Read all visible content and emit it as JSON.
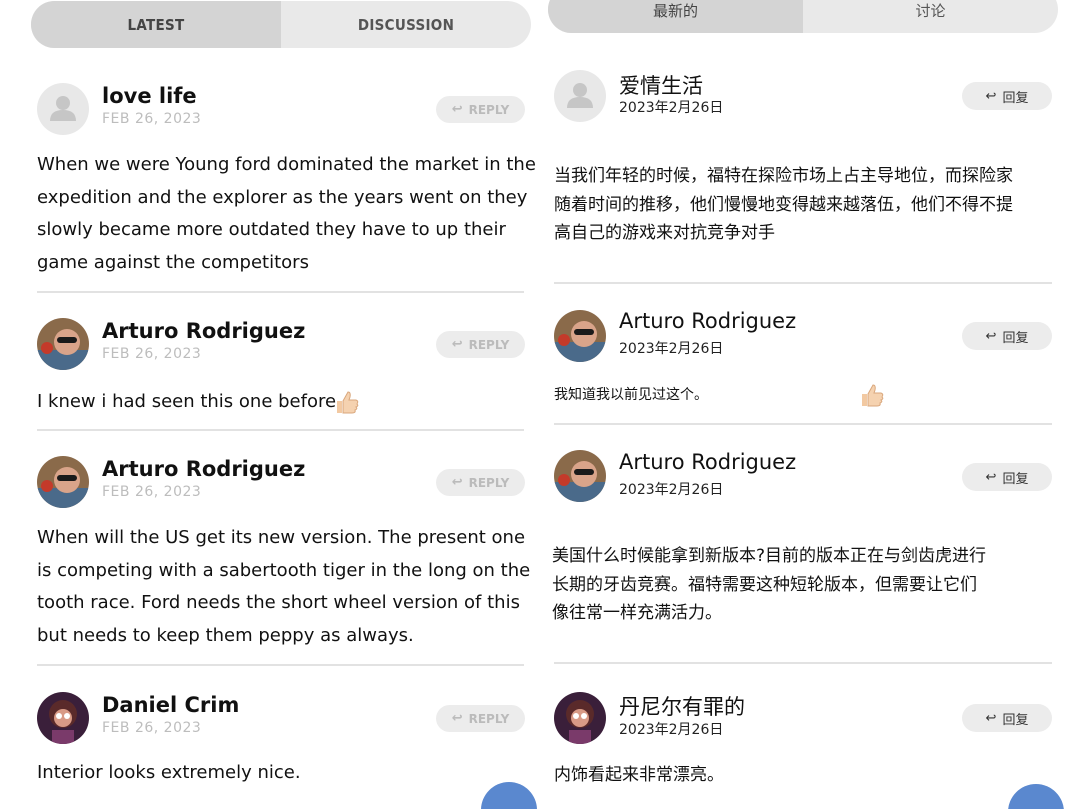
{
  "left": {
    "tabs": [
      {
        "label": "LATEST"
      },
      {
        "label": "DISCUSSION"
      }
    ],
    "reply_label": "REPLY",
    "comments": [
      {
        "name": "love life",
        "date": "FEB 26, 2023",
        "text": "When we were Young ford dominated the market in the\nexpedition and the explorer as the years went on they\nslowly became more outdated they have to up their\ngame against the competitors",
        "avatar": "default-user-icon"
      },
      {
        "name": "Arturo Rodriguez",
        "date": "FEB 26, 2023",
        "text": "I knew i had seen this one before.",
        "avatar": "user-photo"
      },
      {
        "name": "Arturo Rodriguez",
        "date": "FEB 26, 2023",
        "text": "When will the US get its new version. The present one\nis competing with a sabertooth tiger in the long on the\ntooth race. Ford needs the short wheel version of this\nbut needs to keep them peppy as always.",
        "avatar": "user-photo"
      },
      {
        "name": "Daniel Crim",
        "date": "FEB 26, 2023",
        "text": "Interior looks extremely nice.",
        "avatar": "user-photo"
      }
    ]
  },
  "right": {
    "tabs": [
      {
        "label": "最新的"
      },
      {
        "label": "讨论"
      }
    ],
    "reply_label": "回复",
    "comments": [
      {
        "name": "爱情生活",
        "date": "2023年2月26日",
        "text": "当我们年轻的时候，福特在探险市场上占主导地位，而探险家\n随着时间的推移，他们慢慢地变得越来越落伍，他们不得不提\n高自己的游戏来对抗竞争对手",
        "avatar": "default-user-icon"
      },
      {
        "name": "Arturo Rodriguez",
        "date": "2023年2月26日",
        "text": "我知道我以前见过这个。",
        "avatar": "user-photo"
      },
      {
        "name": "Arturo Rodriguez",
        "date": "2023年2月26日",
        "text": "美国什么时候能拿到新版本?目前的版本正在与剑齿虎进行\n长期的牙齿竞赛。福特需要这种短轮版本，但需要让它们\n像往常一样充满活力。",
        "avatar": "user-photo"
      },
      {
        "name": "丹尼尔有罪的",
        "date": "2023年2月26日",
        "text": "内饰看起来非常漂亮。",
        "avatar": "user-photo"
      }
    ]
  },
  "icons": {
    "reply": "reply-arrow-icon",
    "thumbs_up": "thumbs-up-icon",
    "fab": "floating-action-button"
  },
  "colors": {
    "tab_active_bg": "#d4d4d4",
    "tab_bg": "#e9e9e9",
    "reply_bg": "#ececec",
    "divider": "#e2e2e2",
    "fab": "#5a88cf"
  }
}
